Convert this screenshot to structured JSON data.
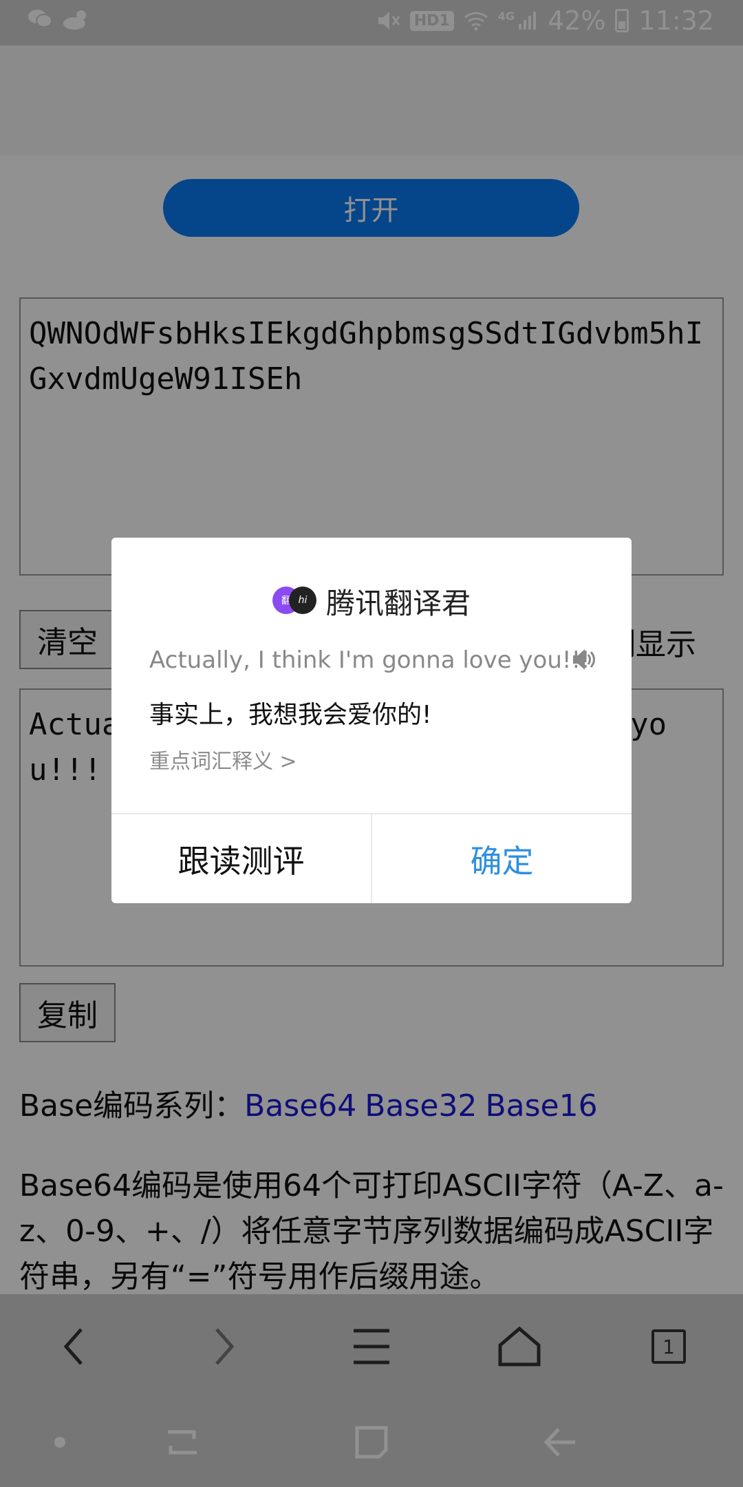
{
  "status_bar": {
    "battery": "42%",
    "time": "11:32",
    "hd_badge": "HD1",
    "network": "4G",
    "icons": [
      "wechat-icon",
      "weather-cloud-sun-icon",
      "mute-icon",
      "hd-icon",
      "wifi-icon",
      "signal-icon",
      "battery-icon"
    ]
  },
  "page": {
    "open_button": "打开",
    "input_text": "QWNOdWFsbHksIEkgdGhpbmsgSSdtIGdvbm5hIGxvdmUgeW91ISEh",
    "clear_button": "清空",
    "display_toggle_label": "制显示",
    "output_text": "Actually, I think I'm gonna love you!!!",
    "copy_button": "复制",
    "base_series_label": "Base编码系列：",
    "base_links": [
      "Base64",
      "Base32",
      "Base16"
    ],
    "description": "Base64编码是使用64个可打印ASCII字符（A-Z、a-z、0-9、+、/）将任意字节序列数据编码成ASCII字符串，另有“=”符号用作后缀用途。"
  },
  "dialog": {
    "app_name": "腾讯翻译君",
    "logo_left_text": "翻",
    "logo_right_text": "hi",
    "source_text": "Actually, I think I'm gonna love you!!!",
    "translated_text": "事实上，我想我会爱你的!",
    "vocab_link": "重点词汇释义 >",
    "read_eval_button": "跟读测评",
    "confirm_button": "确定"
  },
  "browser_toolbar": {
    "tab_count": "1",
    "icons": [
      "back-icon",
      "forward-icon",
      "menu-icon",
      "home-icon",
      "tabs-icon"
    ]
  },
  "system_nav": {
    "icons": [
      "dot-icon",
      "recents-icon",
      "home-square-icon",
      "back-arrow-icon"
    ]
  },
  "colors": {
    "accent": "#0a7cf2",
    "link": "#1a1ad6",
    "confirm": "#2f8fe0",
    "logo_purple": "#8a4cf1"
  }
}
